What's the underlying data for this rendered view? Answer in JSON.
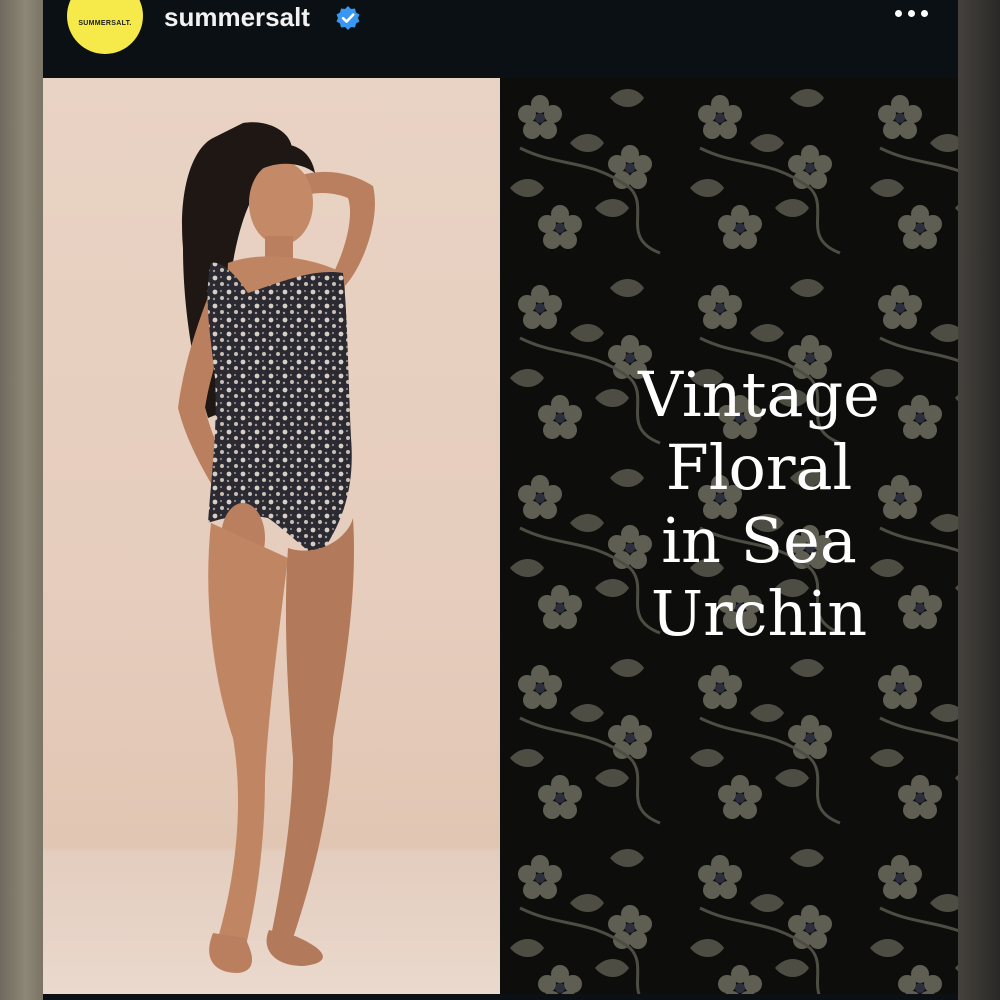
{
  "header": {
    "username": "summersalt",
    "avatar_text": "SUMMERSALT.",
    "verified": true,
    "more_icon": "more-horizontal-icon"
  },
  "post": {
    "title_lines": [
      "Vintage",
      "Floral",
      "in Sea",
      "Urchin"
    ],
    "pattern": "floral-pattern",
    "photo": "model-in-floral-one-piece-swimsuit"
  },
  "colors": {
    "avatar_bg": "#f5ea4a",
    "verified_badge": "#3897f0",
    "header_bg": "#0b1014",
    "pattern_bg": "#0d0d0c",
    "pattern_flowers": "#5f5e52"
  }
}
